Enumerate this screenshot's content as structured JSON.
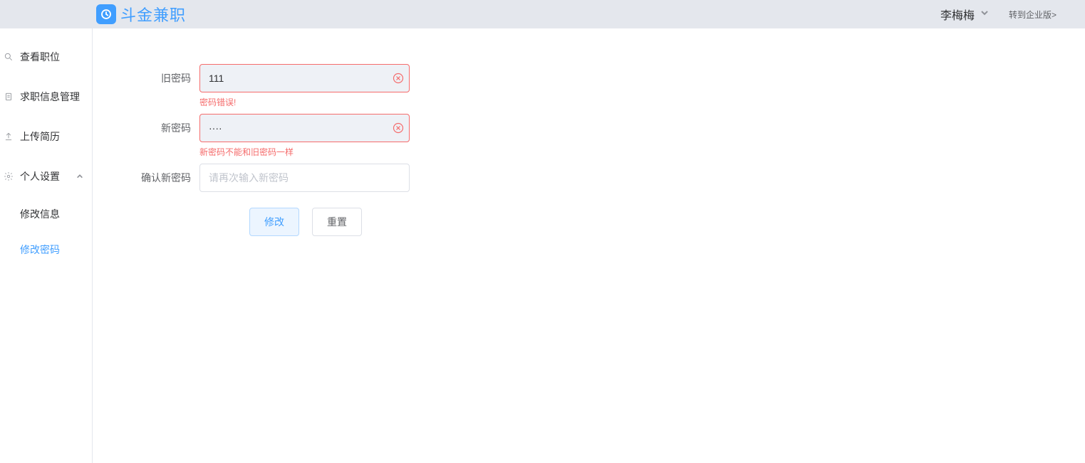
{
  "header": {
    "brand": "斗金兼职",
    "user_name": "李梅梅",
    "to_enterprise": "转到企业版>"
  },
  "sidebar": {
    "items": [
      {
        "label": "查看职位"
      },
      {
        "label": "求职信息管理"
      },
      {
        "label": "上传简历"
      },
      {
        "label": "个人设置"
      }
    ],
    "submenu": [
      {
        "label": "修改信息"
      },
      {
        "label": "修改密码"
      }
    ]
  },
  "form": {
    "old_password": {
      "label": "旧密码",
      "value": "111",
      "error": "密码错误!"
    },
    "new_password": {
      "label": "新密码",
      "value": "····",
      "error": "新密码不能和旧密码一样"
    },
    "confirm_password": {
      "label": "确认新密码",
      "placeholder": "请再次输入新密码"
    },
    "submit_label": "修改",
    "reset_label": "重置"
  }
}
